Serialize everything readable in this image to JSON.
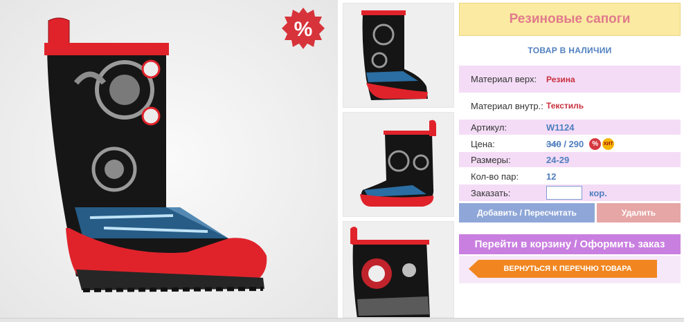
{
  "product": {
    "title": "Резиновые сапоги",
    "stock_status": "ТОВАР В НАЛИЧИИ"
  },
  "sale_badge": "%",
  "specs": {
    "material_top_label": "Материал верх:",
    "material_top_value": "Резина",
    "material_inner_label": "Материал внутр.:",
    "material_inner_value": "Текстиль",
    "article_label": "Артикул:",
    "article_value": "W1124",
    "price_label": "Цена:",
    "price_old": "340",
    "price_sep": " / ",
    "price_new": "290",
    "sizes_label": "Размеры:",
    "sizes_value": "24-29",
    "pairs_label": "Кол-во пар:",
    "pairs_value": "12",
    "order_label": "Заказать:",
    "order_input_value": "",
    "order_unit": "кор."
  },
  "badges": {
    "discount": "%",
    "hit": "ХИТ"
  },
  "buttons": {
    "add": "Добавить / Пересчитать",
    "delete": "Удалить",
    "cart": "Перейти в корзину / Оформить заказ",
    "back": "ВЕРНУТЬСЯ К ПЕРЕЧНЮ ТОВАРА"
  },
  "colors": {
    "title_bg": "#fbeaa1",
    "title_text": "#e07a8c",
    "accent_blue": "#4f7fbf",
    "row_pink": "#f4dcf6",
    "cart_button": "#c97fe0",
    "back_button": "#f18621",
    "boot_red": "#e0232b"
  }
}
